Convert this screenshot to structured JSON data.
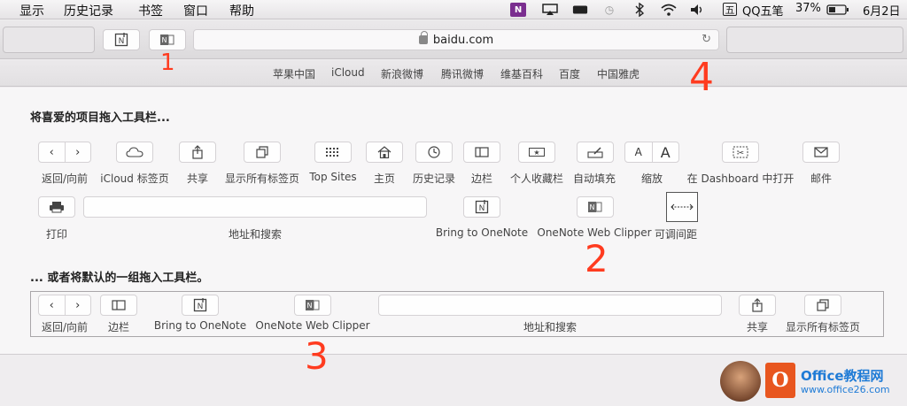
{
  "menubar": {
    "items": [
      "显示",
      "历史记录",
      "书签",
      "窗口",
      "帮助"
    ],
    "input_method": "QQ五笔",
    "battery": "37%",
    "date": "6月2日"
  },
  "toolbar": {
    "address": "baidu.com"
  },
  "bookmarks": [
    "苹果中国",
    "iCloud",
    "新浪微博",
    "腾讯微博",
    "维基百科",
    "百度",
    "中国雅虎"
  ],
  "customize": {
    "heading_favorites": "将喜爱的项目拖入工具栏...",
    "items_row1": [
      {
        "label": "返回/向前"
      },
      {
        "label": "iCloud 标签页"
      },
      {
        "label": "共享"
      },
      {
        "label": "显示所有标签页"
      },
      {
        "label": "Top Sites"
      },
      {
        "label": "主页"
      },
      {
        "label": "历史记录"
      },
      {
        "label": "边栏"
      },
      {
        "label": "个人收藏栏"
      },
      {
        "label": "自动填充"
      },
      {
        "label": "缩放"
      },
      {
        "label": "在 Dashboard 中打开"
      },
      {
        "label": "邮件"
      }
    ],
    "items_row2": [
      {
        "label": "打印"
      },
      {
        "label": "地址和搜索"
      },
      {
        "label": "Bring to OneNote"
      },
      {
        "label": "OneNote Web Clipper"
      },
      {
        "label": "可调间距"
      }
    ],
    "heading_default": "... 或者将默认的一组拖入工具栏。",
    "default_set": [
      {
        "label": "返回/向前"
      },
      {
        "label": "边栏"
      },
      {
        "label": "Bring to OneNote"
      },
      {
        "label": "OneNote Web Clipper"
      },
      {
        "label": "地址和搜索"
      },
      {
        "label": "共享"
      },
      {
        "label": "显示所有标签页"
      }
    ],
    "zoom_glyph": "A"
  },
  "annotations": [
    "1",
    "2",
    "3",
    "4"
  ],
  "watermark": {
    "title": "Office教程网",
    "url": "www.office26.com"
  }
}
